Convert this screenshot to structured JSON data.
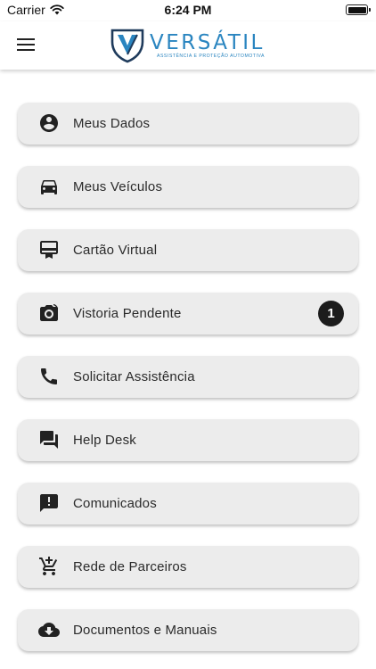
{
  "status_bar": {
    "carrier": "Carrier",
    "time": "6:24 PM",
    "battery_level_pct": 100
  },
  "header": {
    "brand_name": "VERSÁTIL",
    "brand_tagline": "ASSISTÊNCIA E PROTEÇÃO AUTOMOTIVA",
    "brand_color": "#2a85c0"
  },
  "menu": [
    {
      "label": "Meus Dados",
      "icon": "account-circle-icon"
    },
    {
      "label": "Meus Veículos",
      "icon": "car-icon"
    },
    {
      "label": "Cartão Virtual",
      "icon": "card-icon"
    },
    {
      "label": "Vistoria Pendente",
      "icon": "camera-rotate-icon",
      "badge": "1"
    },
    {
      "label": "Solicitar Assistência",
      "icon": "phone-icon"
    },
    {
      "label": "Help Desk",
      "icon": "forum-icon"
    },
    {
      "label": "Comunicados",
      "icon": "announcement-icon"
    },
    {
      "label": "Rede de Parceiros",
      "icon": "cart-plus-icon"
    },
    {
      "label": "Documentos e Manuais",
      "icon": "cloud-download-icon"
    }
  ]
}
